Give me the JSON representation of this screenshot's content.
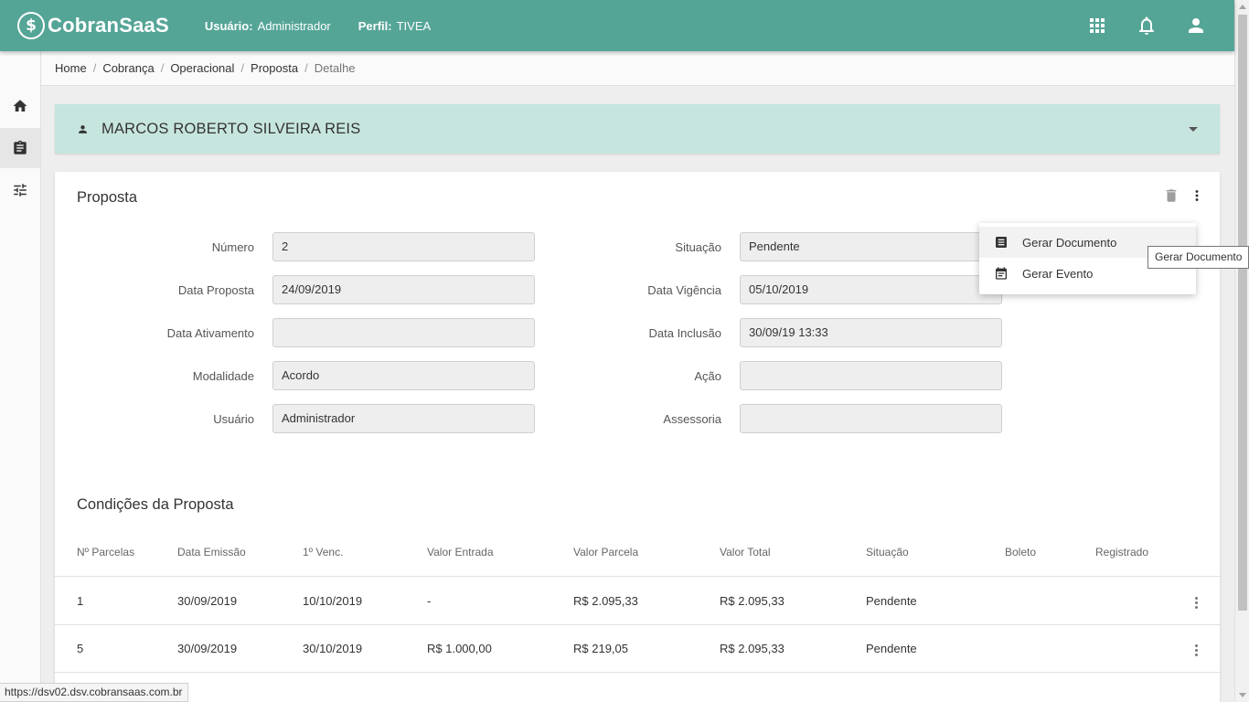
{
  "app": {
    "logo_mark": "$",
    "name": "CobranSaaS"
  },
  "header": {
    "user_label": "Usuário:",
    "user_value": "Administrador",
    "profile_label": "Perfil:",
    "profile_value": "TIVEA",
    "icons": [
      "apps-grid-icon",
      "bell-icon",
      "account-icon"
    ]
  },
  "sidebar": {
    "items": [
      "home-icon",
      "clipboard-icon",
      "tune-icon"
    ],
    "active": 1
  },
  "breadcrumb": [
    "Home",
    "Cobrança",
    "Operacional",
    "Proposta",
    "Detalhe"
  ],
  "person": {
    "name": "MARCOS ROBERTO SILVEIRA REIS"
  },
  "proposal": {
    "title": "Proposta",
    "fields_left": [
      {
        "label": "Número",
        "value": "2"
      },
      {
        "label": "Data Proposta",
        "value": "24/09/2019"
      },
      {
        "label": "Data Ativamento",
        "value": ""
      },
      {
        "label": "Modalidade",
        "value": "Acordo"
      },
      {
        "label": "Usuário",
        "value": "Administrador"
      }
    ],
    "fields_right": [
      {
        "label": "Situação",
        "value": "Pendente"
      },
      {
        "label": "Data Vigência",
        "value": "05/10/2019"
      },
      {
        "label": "Data Inclusão",
        "value": "30/09/19 13:33"
      },
      {
        "label": "Ação",
        "value": ""
      },
      {
        "label": "Assessoria",
        "value": ""
      }
    ]
  },
  "conditions": {
    "title": "Condições da Proposta",
    "columns": [
      "Nº Parcelas",
      "Data Emissão",
      "1º Venc.",
      "Valor Entrada",
      "Valor Parcela",
      "Valor Total",
      "Situação",
      "Boleto",
      "Registrado"
    ],
    "rows": [
      [
        "1",
        "30/09/2019",
        "10/10/2019",
        "-",
        "R$ 2.095,33",
        "R$ 2.095,33",
        "Pendente",
        "",
        ""
      ],
      [
        "5",
        "30/09/2019",
        "30/10/2019",
        "R$ 1.000,00",
        "R$ 219,05",
        "R$ 2.095,33",
        "Pendente",
        "",
        ""
      ]
    ]
  },
  "menu": {
    "items": [
      {
        "label": "Gerar Documento",
        "icon": "document-icon"
      },
      {
        "label": "Gerar Evento",
        "icon": "event-icon"
      }
    ]
  },
  "tooltip": "Gerar Documento",
  "status_url": "https://dsv02.dsv.cobransaas.com.br",
  "colors": {
    "primary": "#55a597",
    "panel": "#c7e5df"
  }
}
